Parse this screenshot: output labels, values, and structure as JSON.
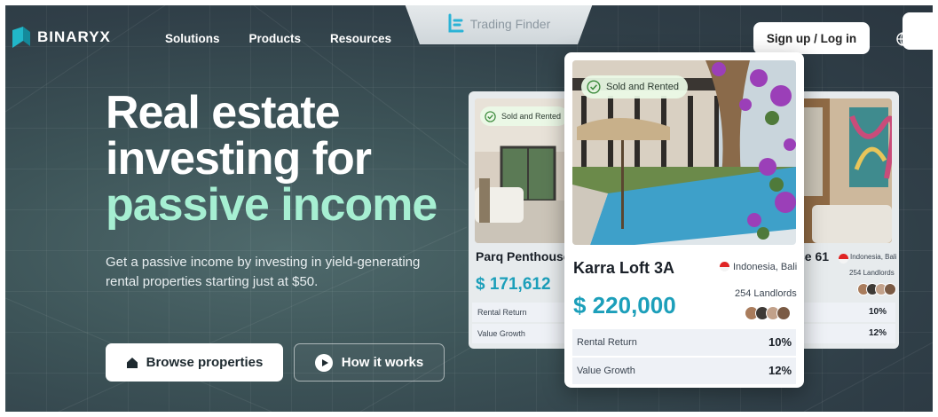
{
  "brand": {
    "name": "BINARYX",
    "accent": "#21b7c9"
  },
  "nav": {
    "items": [
      "Solutions",
      "Products",
      "Resources"
    ]
  },
  "watermark": {
    "text": "Trading Finder"
  },
  "header": {
    "signup_label": "Sign up / Log in"
  },
  "hero": {
    "line1": "Real estate",
    "line2": "investing for",
    "line3": "passive income",
    "line3_color": "#a6efd2",
    "subtext": "Get a passive income by investing in yield-generating rental properties starting just at $50.",
    "browse_label": "Browse properties",
    "how_label": "How it works"
  },
  "cards": {
    "left": {
      "badge": "Sold and Rented",
      "title": "Parq Penthouse",
      "price": "$ 171,612",
      "row1_label": "Rental Return",
      "row2_label": "Value Growth"
    },
    "main": {
      "badge": "Sold and Rented",
      "title": "Karra Loft 3A",
      "location": "Indonesia, Bali",
      "landlords": "254 Landlords",
      "price": "$ 220,000",
      "row1_label": "Rental Return",
      "row1_value": "10%",
      "row2_label": "Value Growth",
      "row2_value": "12%"
    },
    "right": {
      "title": "se 61",
      "location": "Indonesia, Bali",
      "landlords": "254 Landlords",
      "row1_value": "10%",
      "row2_value": "12%"
    }
  }
}
